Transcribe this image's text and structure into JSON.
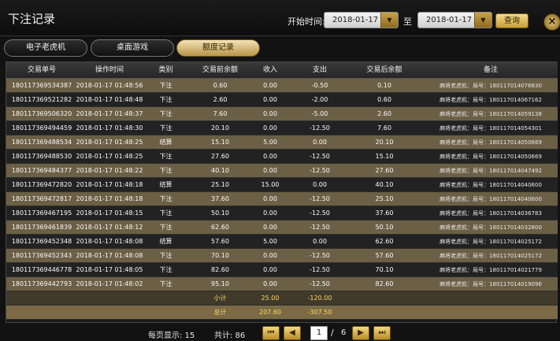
{
  "window": {
    "title": "下注记录",
    "close_icon": "close-icon"
  },
  "filters": {
    "start_label": "开始时间:",
    "start_date": "2018-01-17",
    "to_label": "至",
    "end_date": "2018-01-17",
    "query_label": "查询"
  },
  "tabs": [
    {
      "label": "电子老虎机"
    },
    {
      "label": "桌面游戏"
    },
    {
      "label": "额度记录"
    }
  ],
  "table": {
    "headers": [
      "交易单号",
      "操作时间",
      "类别",
      "交易前余额",
      "收入",
      "支出",
      "交易后余额",
      "备注"
    ],
    "rows": [
      [
        "180117369534387",
        "2018-01-17 01:48:56",
        "下注",
        "0.60",
        "0.00",
        "-0.50",
        "0.10",
        "麻将老虎机：局号：18011701407683​0"
      ],
      [
        "180117369521282",
        "2018-01-17 01:48:48",
        "下注",
        "2.60",
        "0.00",
        "-2.00",
        "0.60",
        "麻将老虎机：局号：180117014067162"
      ],
      [
        "180117369506320",
        "2018-01-17 01:48:37",
        "下注",
        "7.60",
        "0.00",
        "-5.00",
        "2.60",
        "麻将老虎机：局号：180117014059138"
      ],
      [
        "180117369494459",
        "2018-01-17 01:48:30",
        "下注",
        "20.10",
        "0.00",
        "-12.50",
        "7.60",
        "麻将老虎机：局号：180117014054301"
      ],
      [
        "180117369488534",
        "2018-01-17 01:48:25",
        "结算",
        "15.10",
        "5.00",
        "0.00",
        "20.10",
        "麻将老虎机：局号：180117014050669"
      ],
      [
        "180117369488530",
        "2018-01-17 01:48:25",
        "下注",
        "27.60",
        "0.00",
        "-12.50",
        "15.10",
        "麻将老虎机：局号：180117014050669"
      ],
      [
        "180117369484377",
        "2018-01-17 01:48:22",
        "下注",
        "40.10",
        "0.00",
        "-12.50",
        "27.60",
        "麻将老虎机：局号：180117014047492"
      ],
      [
        "180117369472820",
        "2018-01-17 01:48:18",
        "结算",
        "25.10",
        "15.00",
        "0.00",
        "40.10",
        "麻将老虎机：局号：180117014040600"
      ],
      [
        "180117369472817",
        "2018-01-17 01:48:18",
        "下注",
        "37.60",
        "0.00",
        "-12.50",
        "25.10",
        "麻将老虎机：局号：180117014040600"
      ],
      [
        "180117369467195",
        "2018-01-17 01:48:15",
        "下注",
        "50.10",
        "0.00",
        "-12.50",
        "37.60",
        "麻将老虎机：局号：180117014036783"
      ],
      [
        "180117369461839",
        "2018-01-17 01:48:12",
        "下注",
        "62.60",
        "0.00",
        "-12.50",
        "50.10",
        "麻将老虎机：局号：180117014032800"
      ],
      [
        "180117369452348",
        "2018-01-17 01:48:08",
        "结算",
        "57.60",
        "5.00",
        "0.00",
        "62.60",
        "麻将老虎机：局号：180117014025172"
      ],
      [
        "180117369452343",
        "2018-01-17 01:48:08",
        "下注",
        "70.10",
        "0.00",
        "-12.50",
        "57.60",
        "麻将老虎机：局号：180117014025172"
      ],
      [
        "180117369446778",
        "2018-01-17 01:48:05",
        "下注",
        "82.60",
        "0.00",
        "-12.50",
        "70.10",
        "麻将老虎机：局号：180117014021779"
      ],
      [
        "180117369442793",
        "2018-01-17 01:48:02",
        "下注",
        "95.10",
        "0.00",
        "-12.50",
        "82.60",
        "麻将老虎机：局号：180117014019096"
      ]
    ],
    "subtotal": {
      "label": "小计",
      "income": "25.00",
      "expense": "-120.00"
    },
    "total": {
      "label": "总计",
      "income": "207.60",
      "expense": "-307.50"
    }
  },
  "footer": {
    "per_page_label": "每页显示: 15",
    "total_label": "共计: 86",
    "page": "1",
    "slash": "/",
    "pages": "6",
    "first_icon": "first-page-icon",
    "prev_icon": "prev-page-icon",
    "next_icon": "next-page-icon",
    "last_icon": "last-page-icon"
  }
}
